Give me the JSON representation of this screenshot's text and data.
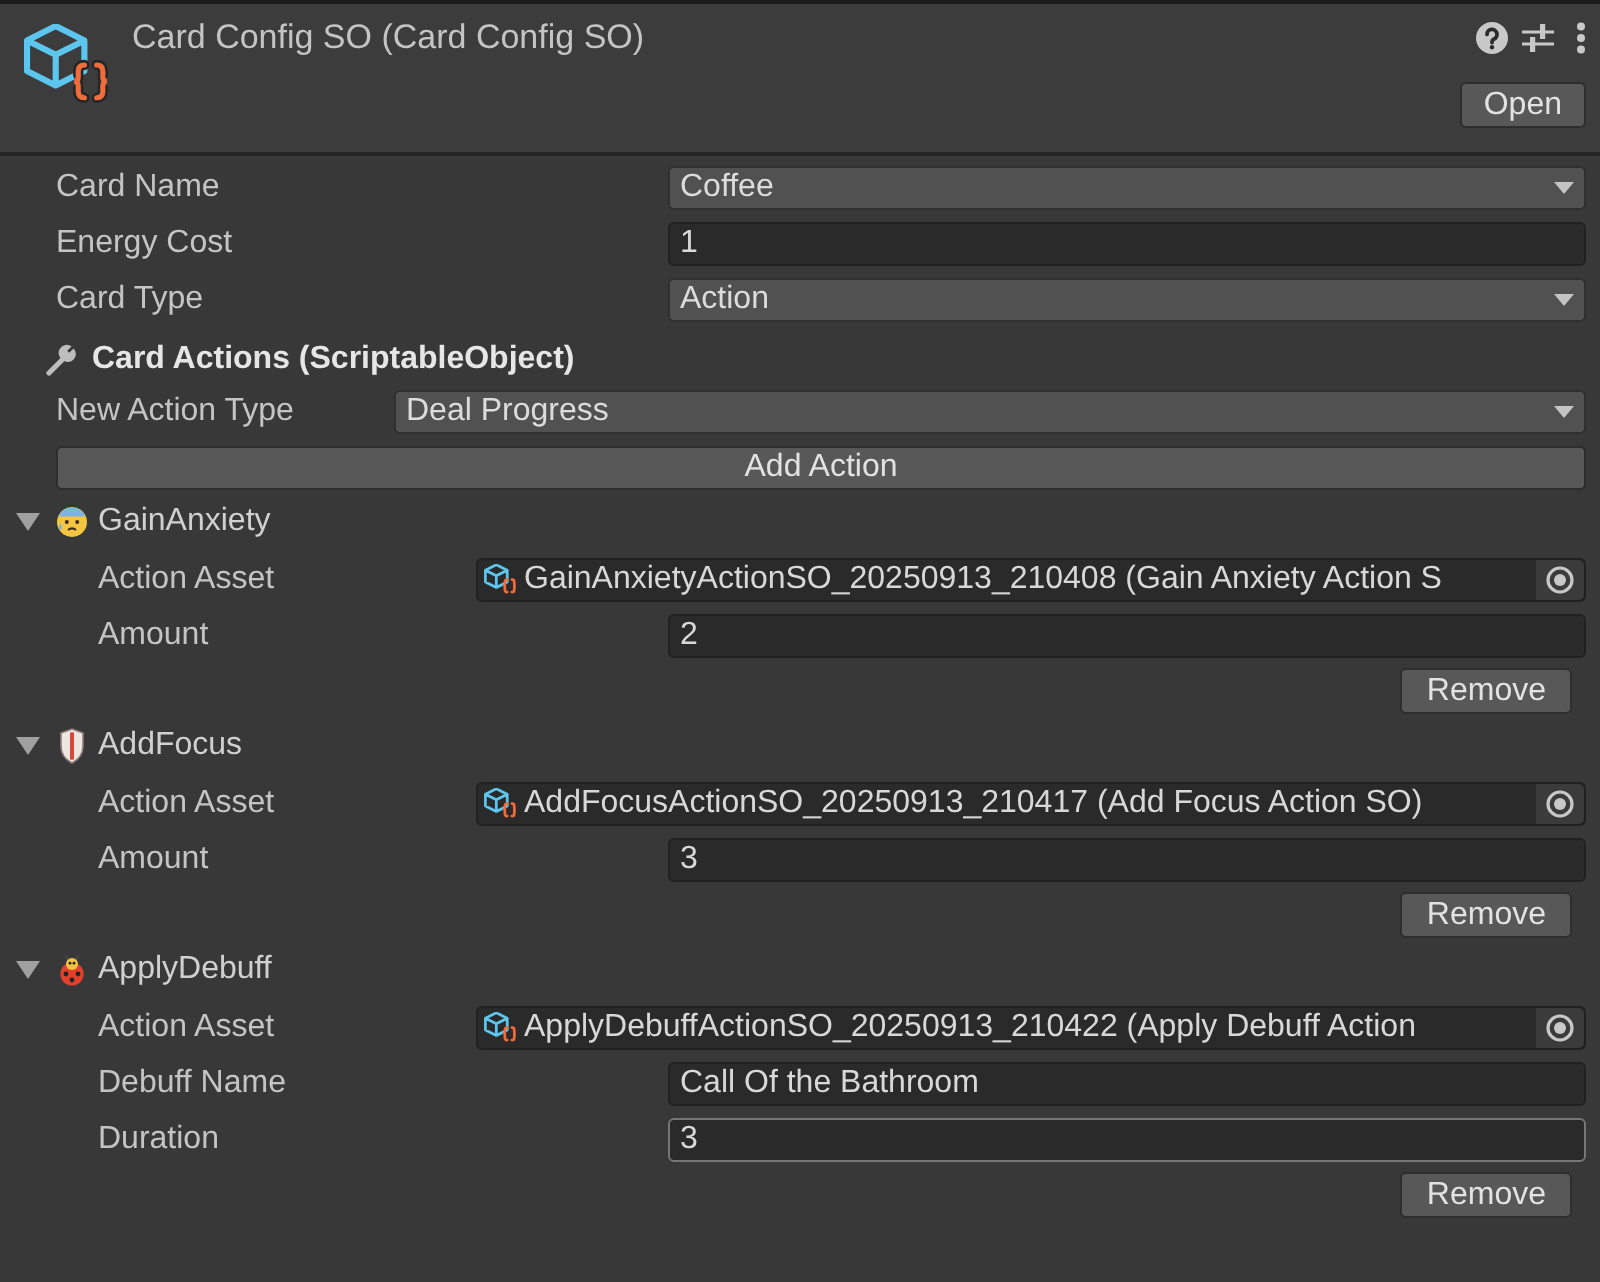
{
  "header": {
    "title": "Card Config SO (Card Config SO)",
    "open_button": "Open"
  },
  "fields": [
    {
      "label": "Card Name",
      "kind": "dropdown",
      "value": "Coffee"
    },
    {
      "label": "Energy Cost",
      "kind": "text",
      "value": "1"
    },
    {
      "label": "Card Type",
      "kind": "dropdown",
      "value": "Action"
    }
  ],
  "card_actions": {
    "title": "Card Actions (ScriptableObject)",
    "new_action_type": {
      "label": "New Action Type",
      "value": "Deal Progress"
    },
    "add_button": "Add Action",
    "actions": [
      {
        "name": "GainAnxiety",
        "expanded": true,
        "properties": [
          {
            "label": "Action Asset",
            "kind": "object",
            "value": "GainAnxietyActionSO_20250913_210408 (Gain Anxiety Action S",
            "focused": false
          },
          {
            "label": "Amount",
            "kind": "text",
            "value": "2",
            "focused": false
          }
        ],
        "remove_button": "Remove"
      },
      {
        "name": "AddFocus",
        "expanded": true,
        "properties": [
          {
            "label": "Action Asset",
            "kind": "object",
            "value": "AddFocusActionSO_20250913_210417 (Add Focus Action SO)",
            "focused": false
          },
          {
            "label": "Amount",
            "kind": "text",
            "value": "3",
            "focused": false
          }
        ],
        "remove_button": "Remove"
      },
      {
        "name": "ApplyDebuff",
        "expanded": true,
        "properties": [
          {
            "label": "Action Asset",
            "kind": "object",
            "value": "ApplyDebuffActionSO_20250913_210422 (Apply Debuff Action",
            "focused": false
          },
          {
            "label": "Debuff Name",
            "kind": "text",
            "value": "Call Of the Bathroom",
            "focused": false
          },
          {
            "label": "Duration",
            "kind": "text",
            "value": "3",
            "focused": true
          }
        ],
        "remove_button": "Remove"
      }
    ]
  }
}
